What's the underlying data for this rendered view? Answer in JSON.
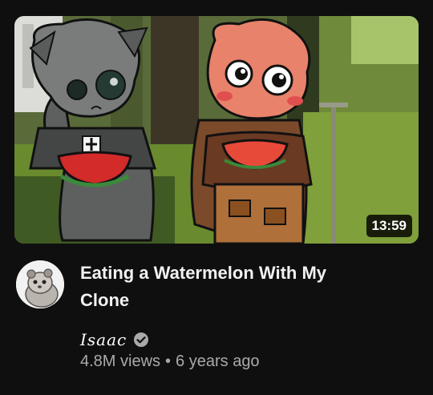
{
  "video": {
    "duration": "13:59",
    "title_line1": "Eating a Watermelon With My",
    "title_line2": "Clone",
    "channel": "Isaac",
    "views": "4.8M views",
    "separator": "•",
    "age": "6 years ago"
  },
  "icons": {
    "verified": "verified-check-icon",
    "avatar": "channel-avatar-ferret"
  },
  "colors": {
    "background": "#0f0f0f",
    "title": "#f1f1f1",
    "meta": "#aaaaaa"
  }
}
